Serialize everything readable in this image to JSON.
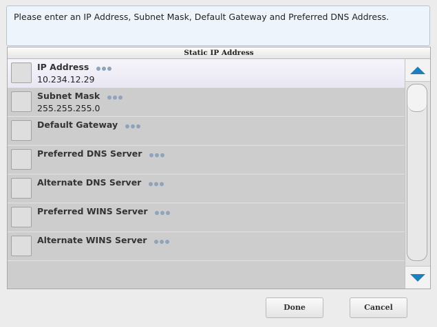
{
  "instructions": "Please enter an IP Address, Subnet Mask, Default Gateway and Preferred DNS Address.",
  "panel": {
    "title": "Static IP Address"
  },
  "fields": [
    {
      "label": "IP Address",
      "value": "10.234.12.29",
      "selected": true
    },
    {
      "label": "Subnet Mask",
      "value": "255.255.255.0",
      "selected": false
    },
    {
      "label": "Default Gateway",
      "value": "",
      "selected": false
    },
    {
      "label": "Preferred DNS Server",
      "value": "",
      "selected": false
    },
    {
      "label": "Alternate DNS Server",
      "value": "",
      "selected": false
    },
    {
      "label": "Preferred WINS Server",
      "value": "",
      "selected": false
    },
    {
      "label": "Alternate WINS Server",
      "value": "",
      "selected": false
    }
  ],
  "scrollbar": {
    "up_icon": "triangle-up-icon",
    "down_icon": "triangle-down-icon",
    "accent": "#1f7fbe"
  },
  "buttons": {
    "done": "Done",
    "cancel": "Cancel"
  }
}
